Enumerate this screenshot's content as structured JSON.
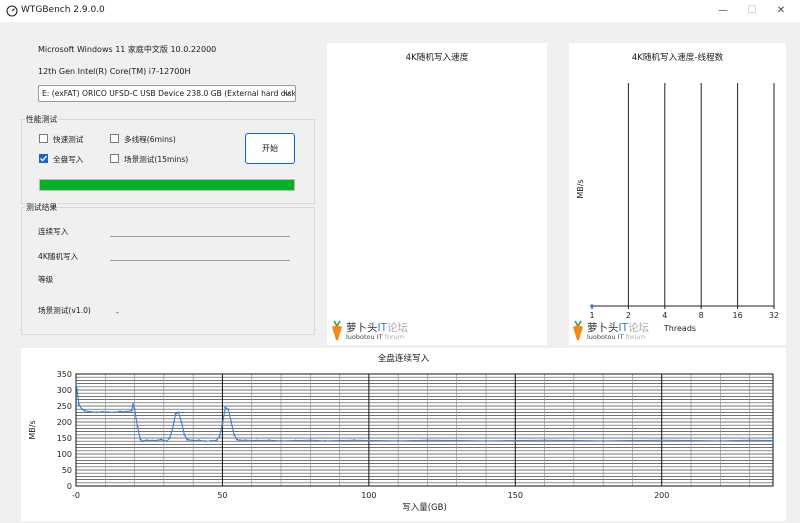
{
  "window": {
    "title": "WTGBench 2.9.0.0",
    "minimize_glyph": "—",
    "maximize_glyph": "☐",
    "close_glyph": "✕"
  },
  "system": {
    "os": "Microsoft Windows 11 家庭中文版 10.0.22000",
    "cpu": "12th Gen Intel(R) Core(TM) i7-12700H",
    "drive": "E:  (exFAT) ORICO UFSD-C USB Device 238.0 GB (External hard disk m"
  },
  "perf_test": {
    "label": "性能测试",
    "options": [
      {
        "label": "快速测试",
        "checked": false
      },
      {
        "label": "多线程(6mins)",
        "checked": false
      },
      {
        "label": "全盘写入",
        "checked": true
      },
      {
        "label": "场景测试(15mins)",
        "checked": false
      }
    ],
    "start_label": "开始",
    "progress": 1.0,
    "progress_color": "#06b025"
  },
  "results": {
    "label": "测试结果",
    "seq_write_label": "连续写入",
    "rand4k_label": "4K随机写入",
    "grade_label": "等级",
    "scene_label": "场景测试(v1.0)",
    "scene_value": "-"
  },
  "watermark": {
    "brand": "萝卜头",
    "it": "IT",
    "forum": "论坛",
    "sub_main": "luobotou IT",
    "sub_forum": "forum",
    "icon": "carrot-icon"
  },
  "chart_data": [
    {
      "type": "line",
      "title": "4K随机写入速度",
      "series": []
    },
    {
      "type": "line",
      "title": "4K随机写入速度-线程数",
      "xlabel": "Threads",
      "ylabel": "MB/s",
      "x": [
        1,
        2,
        4,
        8,
        16,
        32
      ],
      "x_ticks": [
        "1",
        "2",
        "4",
        "8",
        "16",
        "32"
      ],
      "points": [
        {
          "x": 1,
          "y": 0
        }
      ],
      "grid": "vertical"
    },
    {
      "type": "line",
      "title": "全盘连续写入",
      "xlabel": "写入量(GB)",
      "ylabel": "MB/s",
      "xlim": [
        0,
        238
      ],
      "ylim": [
        0,
        350
      ],
      "x_ticks": [
        "-0",
        "50",
        "100",
        "150",
        "200"
      ],
      "x_tick_values": [
        0,
        50,
        100,
        150,
        200
      ],
      "y_ticks": [
        "350",
        "300",
        "250",
        "200",
        "150",
        "100",
        "50",
        "0"
      ],
      "y_tick_values": [
        350,
        300,
        250,
        200,
        150,
        100,
        50,
        0
      ],
      "line_color": "#3c7fd8",
      "series": [
        {
          "x": [
            0,
            0.5,
            1,
            2,
            3,
            5,
            7,
            9,
            11,
            13,
            15,
            17,
            19,
            19.5,
            20,
            21,
            22,
            23,
            24,
            26,
            28,
            29,
            30,
            31,
            32,
            33,
            34,
            35,
            36,
            37,
            38,
            40,
            42,
            44,
            46,
            48,
            49,
            50,
            51,
            52,
            53,
            54,
            55,
            56,
            58,
            62,
            66,
            70,
            75,
            80,
            85,
            90,
            95,
            100,
            110,
            120,
            130,
            140,
            150,
            160,
            170,
            180,
            190,
            200,
            210,
            220,
            230,
            238
          ],
          "y": [
            325,
            290,
            255,
            240,
            235,
            232,
            230,
            232,
            231,
            230,
            233,
            232,
            235,
            255,
            240,
            185,
            145,
            140,
            143,
            142,
            143,
            145,
            142,
            140,
            150,
            180,
            225,
            230,
            200,
            160,
            145,
            142,
            143,
            140,
            141,
            143,
            155,
            195,
            245,
            240,
            200,
            160,
            145,
            143,
            143,
            142,
            143,
            141,
            142,
            143,
            141,
            142,
            143,
            142,
            141,
            143,
            142,
            141,
            142,
            143,
            142,
            141,
            142,
            143,
            142,
            141,
            143,
            142
          ]
        }
      ]
    }
  ]
}
